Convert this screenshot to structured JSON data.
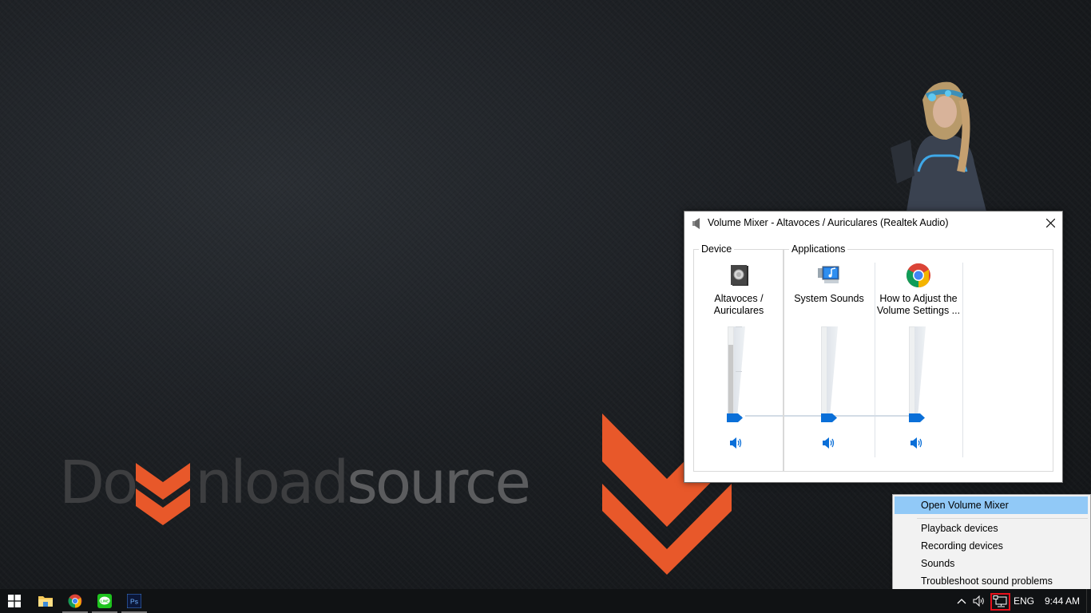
{
  "desktop": {
    "logo": {
      "part1": "Do",
      "part2": "nload",
      "part3": "source",
      "accent_color": "#e8582a"
    }
  },
  "mixer": {
    "title": "Volume Mixer - Altavoces / Auriculares (Realtek Audio)",
    "close_label": "✕",
    "device_group_label": "Device",
    "applications_group_label": "Applications",
    "accent_color": "#0a6fd8",
    "channels": [
      {
        "label_line1": "Altavoces /",
        "label_line2": "Auriculares",
        "icon": "speaker-device-icon",
        "volume_percent": 0,
        "level_percent": 80
      },
      {
        "label_line1": "System Sounds",
        "label_line2": "",
        "icon": "system-sounds-icon",
        "volume_percent": 0,
        "level_percent": 0
      },
      {
        "label_line1": "How to Adjust the",
        "label_line2": "Volume Settings ...",
        "icon": "chrome-icon",
        "volume_percent": 0,
        "level_percent": 0
      }
    ]
  },
  "context_menu": {
    "items": [
      {
        "label": "Open Volume Mixer",
        "highlighted": true
      },
      {
        "label": "Playback devices"
      },
      {
        "label": "Recording devices"
      },
      {
        "label": "Sounds"
      },
      {
        "label": "Troubleshoot sound problems"
      }
    ]
  },
  "taskbar": {
    "pinned": [
      {
        "name": "start-button",
        "icon": "windows-icon"
      },
      {
        "name": "file-explorer",
        "icon": "folder-icon"
      },
      {
        "name": "chrome",
        "icon": "chrome-icon"
      },
      {
        "name": "line",
        "icon": "line-icon",
        "text": "LINE"
      },
      {
        "name": "photoshop",
        "icon": "photoshop-icon",
        "text": "Ps"
      }
    ],
    "tray": {
      "language": "ENG",
      "time": "9:44 AM"
    }
  }
}
